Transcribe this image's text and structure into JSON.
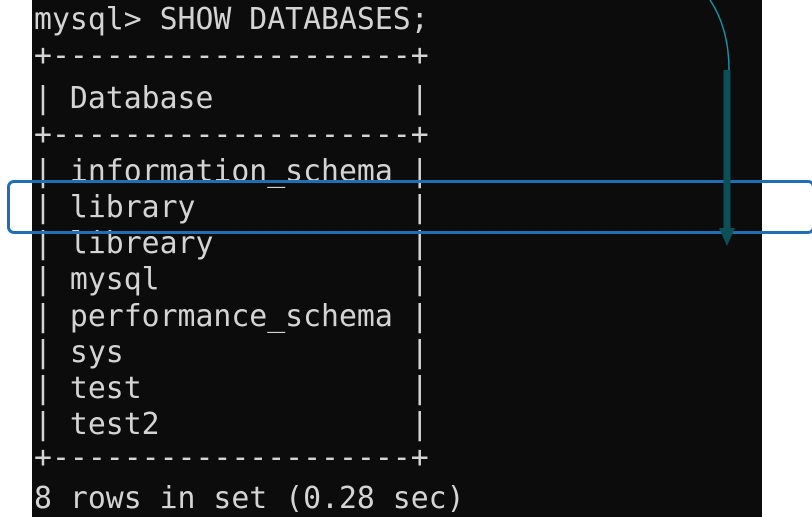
{
  "terminal": {
    "lines": [
      "mysql> SHOW DATABASES;",
      "+--------------------+",
      "| Database           |",
      "+--------------------+",
      "| information_schema |",
      "| library            |",
      "| librеary           |",
      "| mysql              |",
      "| performance_schema |",
      "| sys                |",
      "| test               |",
      "| test2              |",
      "+--------------------+",
      "8 rows in set (0.28 sec)"
    ],
    "background_color": "#0c0c0c",
    "text_color": "#d4d4d4"
  },
  "annotation": {
    "highlight_color": "#1f6fb2",
    "arrow_color": "#0b4f57",
    "arrow_icon": "down-arrow-icon",
    "highlighted_row": "library"
  }
}
